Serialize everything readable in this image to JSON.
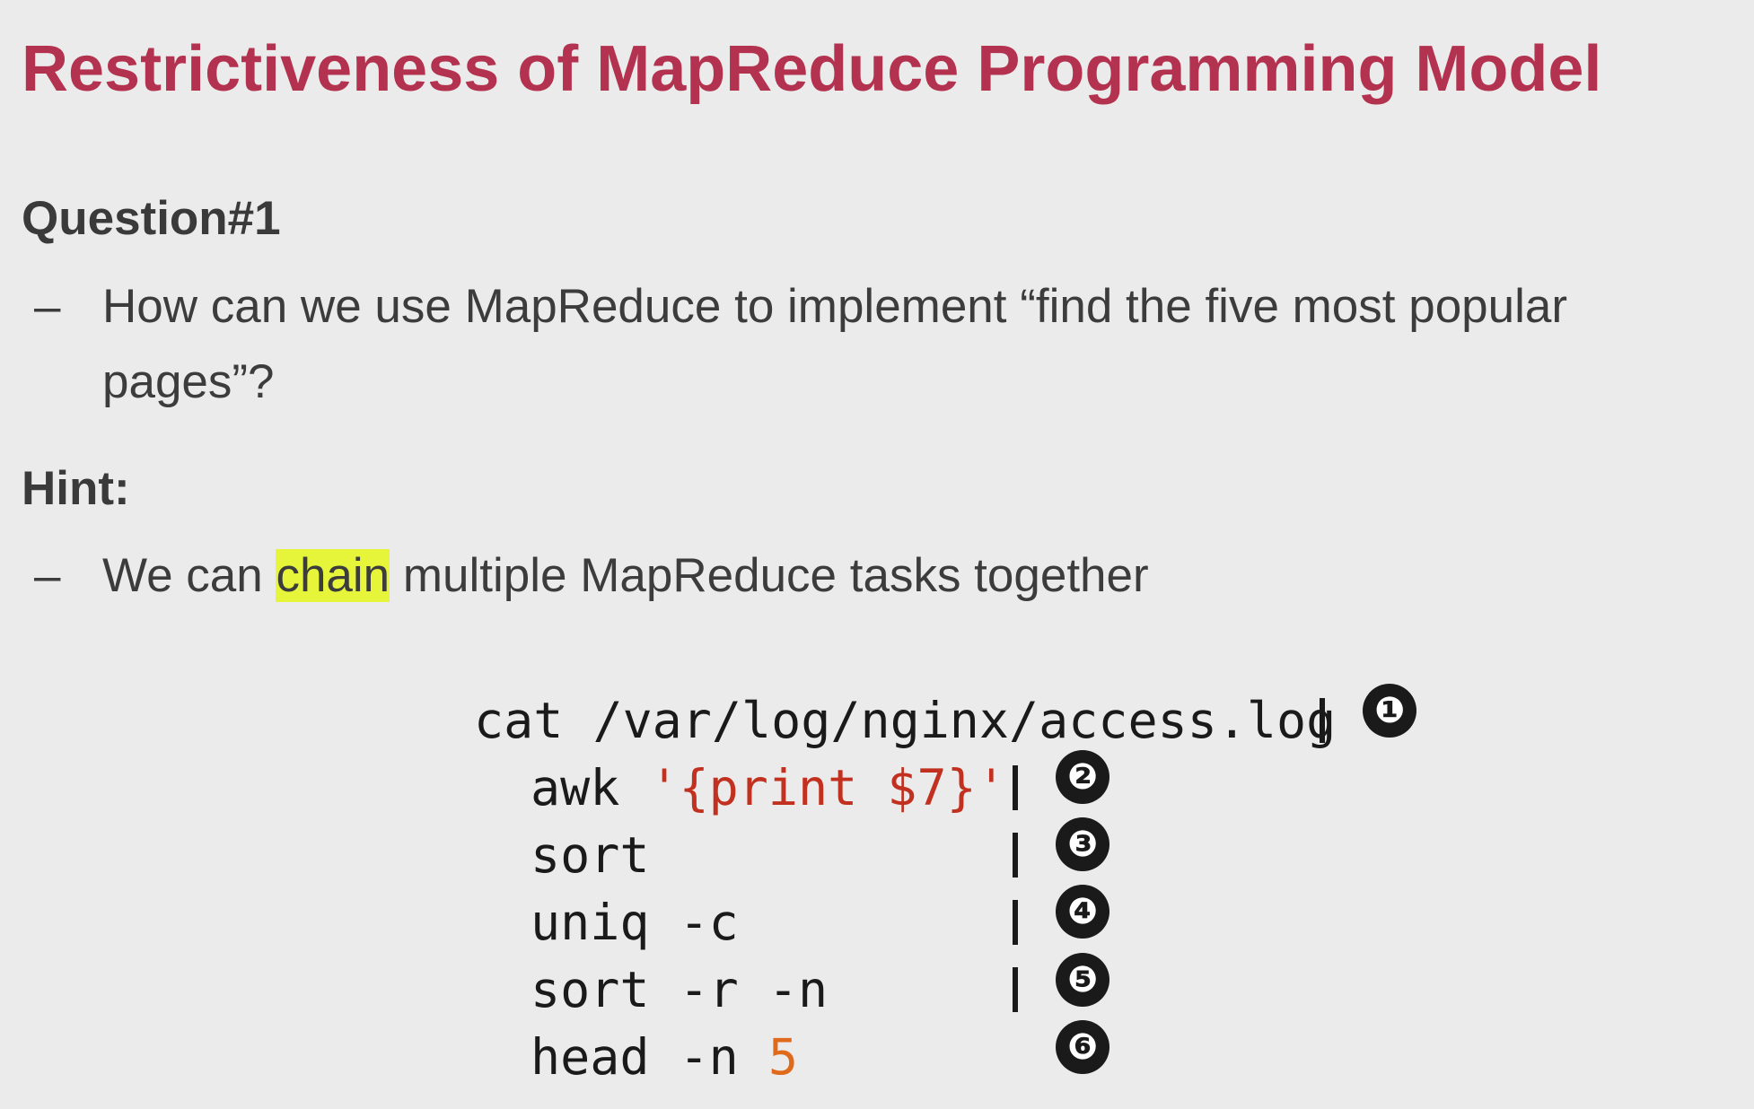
{
  "slide": {
    "title": "Restrictiveness of MapReduce Programming Model",
    "question_heading": "Question#1",
    "question_dash": "–",
    "question_text": "How can we use MapReduce to implement “find the five most popular pages”?",
    "hint_heading": "Hint:",
    "hint_dash": "–",
    "hint_before": "We can ",
    "hint_highlight": "chain",
    "hint_after": " multiple MapReduce tasks together",
    "highlight_color": "#e6f53a",
    "title_color": "#b3324f"
  },
  "code": {
    "line1": "cat /var/log/nginx/access.log",
    "line2_cmd": "awk ",
    "line2_str": "'{print $7}'",
    "line3": "sort",
    "line4": "uniq -c",
    "line5": "sort -r -n",
    "line6_cmd": "head -n ",
    "line6_num": "5",
    "badges": [
      "❶",
      "❷",
      "❸",
      "❹",
      "❺",
      "❻"
    ]
  }
}
